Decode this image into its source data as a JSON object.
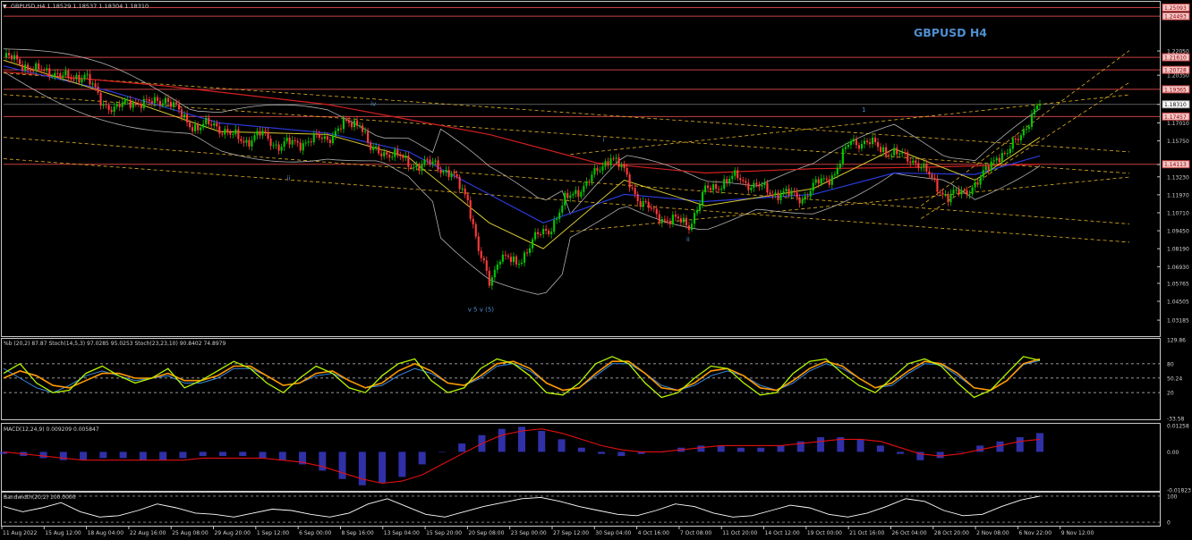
{
  "window": {
    "header": "GBPUSD,H4  1.18529 1.18537 1.18304 1.18310",
    "symbol_title": "GBPUSD H4"
  },
  "colors": {
    "background": "#000000",
    "bull": "#00c800",
    "bear": "#ff3b3b",
    "ma_slow": "#d42020",
    "ma_mid": "#2a3ad8",
    "ma_fast": "#d8c830",
    "bands": "#b0b0b0",
    "channel": "#e0b020",
    "hline": "#c84040",
    "title": "#4f8fd0",
    "stoch_main": "#b5f500",
    "stoch_fast": "#ff9a00",
    "pctb": "#3a8ae0",
    "macd_hist": "#4040e0",
    "macd_signal": "#e01010",
    "bandwidth": "#ffffff"
  },
  "chart_data": {
    "type": "candlestick",
    "ylim": [
      1.02,
      1.255
    ],
    "x_labels": [
      "11 Aug 2022",
      "15 Aug 12:00",
      "18 Aug 04:00",
      "22 Aug 16:00",
      "25 Aug 08:00",
      "29 Aug 20:00",
      "1 Sep 12:00",
      "6 Sep 00:00",
      "8 Sep 16:00",
      "13 Sep 04:00",
      "15 Sep 20:00",
      "20 Sep 08:00",
      "23 Sep 00:00",
      "27 Sep 12:00",
      "30 Sep 04:00",
      "4 Oct 16:00",
      "7 Oct 08:00",
      "11 Oct 20:00",
      "14 Oct 12:00",
      "19 Oct 00:00",
      "21 Oct 16:00",
      "26 Oct 04:00",
      "28 Oct 20:00",
      "2 Nov 08:00",
      "6 Nov 22:00",
      "9 Nov 12:00"
    ],
    "y_ticks": [
      "1.22050",
      "1.20350",
      "1.18310",
      "1.17010",
      "1.15750",
      "1.14090",
      "1.13230",
      "1.11970",
      "1.10710",
      "1.09450",
      "1.08190",
      "1.06930",
      "1.05765",
      "1.04505",
      "1.03185"
    ],
    "price_boxes": [
      {
        "label": "1.25093",
        "value": 1.25093
      },
      {
        "label": "1.24493",
        "value": 1.24493
      },
      {
        "label": "1.21610",
        "value": 1.2161
      },
      {
        "label": "1.20728",
        "value": 1.20728
      },
      {
        "label": "1.19365",
        "value": 1.19365
      },
      {
        "label": "1.17457",
        "value": 1.17457
      },
      {
        "label": "1.14113",
        "value": 1.14113
      }
    ],
    "current_price": {
      "label": "1.18310",
      "value": 1.1831
    },
    "wave_labels": [
      {
        "text": "iv",
        "value": 1.182,
        "bar": 136
      },
      {
        "text": "ii",
        "value": 1.13,
        "bar": 105
      },
      {
        "text": "i",
        "value": 1.157,
        "bar": 222
      },
      {
        "text": "ii",
        "value": 1.087,
        "bar": 253
      },
      {
        "text": "1",
        "value": 1.178,
        "bar": 318
      },
      {
        "text": "v  5  v (5)",
        "value": 1.038,
        "bar": 172
      }
    ],
    "series": [
      {
        "name": "Price",
        "points": [
          {
            "x": 0,
            "y": 1.216
          },
          {
            "x": 6,
            "y": 1.213
          },
          {
            "x": 12,
            "y": 1.206
          },
          {
            "x": 18,
            "y": 1.207
          },
          {
            "x": 24,
            "y": 1.2
          },
          {
            "x": 30,
            "y": 1.205
          },
          {
            "x": 36,
            "y": 1.185
          },
          {
            "x": 42,
            "y": 1.18
          },
          {
            "x": 48,
            "y": 1.186
          },
          {
            "x": 54,
            "y": 1.183
          },
          {
            "x": 60,
            "y": 1.188
          },
          {
            "x": 66,
            "y": 1.175
          },
          {
            "x": 72,
            "y": 1.166
          },
          {
            "x": 78,
            "y": 1.17
          },
          {
            "x": 84,
            "y": 1.161
          },
          {
            "x": 90,
            "y": 1.158
          },
          {
            "x": 96,
            "y": 1.162
          },
          {
            "x": 102,
            "y": 1.154
          },
          {
            "x": 108,
            "y": 1.156
          },
          {
            "x": 114,
            "y": 1.158
          },
          {
            "x": 120,
            "y": 1.16
          },
          {
            "x": 126,
            "y": 1.168
          },
          {
            "x": 132,
            "y": 1.172
          },
          {
            "x": 136,
            "y": 1.15
          },
          {
            "x": 142,
            "y": 1.15
          },
          {
            "x": 148,
            "y": 1.144
          },
          {
            "x": 154,
            "y": 1.14
          },
          {
            "x": 160,
            "y": 1.142
          },
          {
            "x": 166,
            "y": 1.133
          },
          {
            "x": 172,
            "y": 1.118
          },
          {
            "x": 176,
            "y": 1.08
          },
          {
            "x": 180,
            "y": 1.058
          },
          {
            "x": 184,
            "y": 1.078
          },
          {
            "x": 190,
            "y": 1.07
          },
          {
            "x": 196,
            "y": 1.088
          },
          {
            "x": 202,
            "y": 1.095
          },
          {
            "x": 208,
            "y": 1.115
          },
          {
            "x": 214,
            "y": 1.125
          },
          {
            "x": 220,
            "y": 1.135
          },
          {
            "x": 225,
            "y": 1.148
          },
          {
            "x": 230,
            "y": 1.135
          },
          {
            "x": 236,
            "y": 1.115
          },
          {
            "x": 242,
            "y": 1.105
          },
          {
            "x": 248,
            "y": 1.102
          },
          {
            "x": 254,
            "y": 1.099
          },
          {
            "x": 260,
            "y": 1.122
          },
          {
            "x": 266,
            "y": 1.128
          },
          {
            "x": 272,
            "y": 1.132
          },
          {
            "x": 278,
            "y": 1.126
          },
          {
            "x": 284,
            "y": 1.122
          },
          {
            "x": 290,
            "y": 1.12
          },
          {
            "x": 296,
            "y": 1.118
          },
          {
            "x": 302,
            "y": 1.128
          },
          {
            "x": 308,
            "y": 1.135
          },
          {
            "x": 314,
            "y": 1.158
          },
          {
            "x": 320,
            "y": 1.156
          },
          {
            "x": 326,
            "y": 1.152
          },
          {
            "x": 332,
            "y": 1.147
          },
          {
            "x": 338,
            "y": 1.144
          },
          {
            "x": 344,
            "y": 1.13
          },
          {
            "x": 350,
            "y": 1.118
          },
          {
            "x": 356,
            "y": 1.122
          },
          {
            "x": 362,
            "y": 1.13
          },
          {
            "x": 368,
            "y": 1.148
          },
          {
            "x": 372,
            "y": 1.148
          },
          {
            "x": 378,
            "y": 1.166
          },
          {
            "x": 384,
            "y": 1.1831
          }
        ]
      }
    ],
    "ma_levels": {
      "slow": [
        [
          0,
          1.206
        ],
        [
          60,
          1.196
        ],
        [
          120,
          1.183
        ],
        [
          180,
          1.162
        ],
        [
          220,
          1.142
        ],
        [
          260,
          1.135
        ],
        [
          300,
          1.138
        ],
        [
          340,
          1.139
        ],
        [
          384,
          1.141
        ]
      ],
      "mid": [
        [
          0,
          1.21
        ],
        [
          40,
          1.192
        ],
        [
          80,
          1.17
        ],
        [
          120,
          1.163
        ],
        [
          150,
          1.15
        ],
        [
          180,
          1.12
        ],
        [
          200,
          1.1
        ],
        [
          230,
          1.12
        ],
        [
          260,
          1.115
        ],
        [
          300,
          1.12
        ],
        [
          330,
          1.135
        ],
        [
          360,
          1.134
        ],
        [
          384,
          1.147
        ]
      ],
      "fast": [
        [
          0,
          1.214
        ],
        [
          40,
          1.19
        ],
        [
          80,
          1.164
        ],
        [
          120,
          1.162
        ],
        [
          150,
          1.146
        ],
        [
          180,
          1.1
        ],
        [
          200,
          1.082
        ],
        [
          230,
          1.13
        ],
        [
          260,
          1.112
        ],
        [
          300,
          1.124
        ],
        [
          330,
          1.152
        ],
        [
          360,
          1.13
        ],
        [
          384,
          1.16
        ]
      ]
    },
    "channels": [
      [
        [
          0,
          1.205
        ],
        [
          384,
          1.155
        ]
      ],
      [
        [
          0,
          1.19
        ],
        [
          384,
          1.14
        ]
      ],
      [
        [
          0,
          1.16
        ],
        [
          384,
          1.105
        ]
      ],
      [
        [
          0,
          1.145
        ],
        [
          384,
          1.092
        ]
      ],
      [
        [
          210,
          1.148
        ],
        [
          384,
          1.182
        ]
      ],
      [
        [
          210,
          1.094
        ],
        [
          384,
          1.125
        ]
      ],
      [
        [
          340,
          1.103
        ],
        [
          384,
          1.153
        ]
      ],
      [
        [
          340,
          1.112
        ],
        [
          384,
          1.169
        ]
      ]
    ],
    "indicators": {
      "stoch": {
        "label": "%b (20,2) 87.87  Stoch(14,5,3) 97.0285 95.0253  Stoch(23,23,10) 90.8402 74.8979",
        "ylim": [
          -33.58,
          129.86
        ],
        "y_ticks": [
          "129.86",
          "80",
          "50.24",
          "20",
          "-33.58"
        ],
        "main": [
          60,
          80,
          40,
          20,
          25,
          60,
          75,
          55,
          40,
          50,
          70,
          30,
          45,
          65,
          85,
          70,
          40,
          20,
          50,
          75,
          60,
          30,
          20,
          55,
          80,
          90,
          45,
          20,
          30,
          70,
          90,
          80,
          55,
          20,
          15,
          40,
          80,
          95,
          80,
          40,
          10,
          20,
          50,
          75,
          70,
          40,
          15,
          20,
          60,
          85,
          90,
          60,
          35,
          20,
          50,
          80,
          90,
          75,
          40,
          10,
          25,
          60,
          95,
          87
        ],
        "slow": [
          50,
          65,
          55,
          35,
          30,
          45,
          60,
          60,
          50,
          50,
          60,
          45,
          45,
          55,
          75,
          75,
          55,
          35,
          40,
          60,
          65,
          45,
          30,
          40,
          65,
          80,
          65,
          40,
          35,
          55,
          80,
          85,
          70,
          40,
          25,
          30,
          60,
          85,
          85,
          60,
          30,
          25,
          40,
          65,
          70,
          55,
          30,
          25,
          45,
          70,
          85,
          75,
          50,
          30,
          40,
          65,
          85,
          80,
          60,
          30,
          25,
          45,
          80,
          90
        ],
        "pctb": [
          70,
          50,
          30,
          20,
          35,
          55,
          65,
          55,
          45,
          50,
          55,
          40,
          40,
          50,
          70,
          70,
          55,
          35,
          40,
          55,
          60,
          45,
          30,
          35,
          55,
          70,
          60,
          40,
          35,
          50,
          75,
          80,
          65,
          40,
          25,
          30,
          55,
          80,
          80,
          60,
          35,
          25,
          35,
          55,
          65,
          55,
          35,
          25,
          40,
          65,
          80,
          70,
          50,
          30,
          35,
          60,
          80,
          78,
          55,
          30,
          25,
          45,
          78,
          87
        ]
      },
      "macd": {
        "label": "MACD(12,24,9) 0.009209 0.005847",
        "ylim": [
          -0.01823,
          0.01258
        ],
        "y_ticks": [
          "0.01258",
          "0.00",
          "-0.01823"
        ],
        "hist": [
          -0.001,
          -0.002,
          -0.003,
          -0.004,
          -0.004,
          -0.003,
          -0.003,
          -0.004,
          -0.004,
          -0.003,
          -0.002,
          -0.002,
          -0.002,
          -0.003,
          -0.004,
          -0.006,
          -0.009,
          -0.013,
          -0.016,
          -0.015,
          -0.012,
          -0.006,
          0.0,
          0.004,
          0.008,
          0.011,
          0.012,
          0.01,
          0.006,
          0.002,
          -0.001,
          -0.002,
          -0.001,
          0.0,
          0.002,
          0.003,
          0.003,
          0.002,
          0.002,
          0.003,
          0.005,
          0.007,
          0.007,
          0.006,
          0.003,
          -0.001,
          -0.004,
          -0.003,
          0.0,
          0.003,
          0.005,
          0.007,
          0.009
        ],
        "signal": [
          0.0,
          -0.001,
          -0.002,
          -0.003,
          -0.004,
          -0.004,
          -0.004,
          -0.004,
          -0.004,
          -0.004,
          -0.003,
          -0.003,
          -0.003,
          -0.003,
          -0.004,
          -0.005,
          -0.007,
          -0.01,
          -0.013,
          -0.015,
          -0.014,
          -0.011,
          -0.006,
          -0.001,
          0.004,
          0.008,
          0.01,
          0.011,
          0.009,
          0.006,
          0.003,
          0.001,
          0.0,
          0.0,
          0.001,
          0.002,
          0.003,
          0.003,
          0.003,
          0.003,
          0.004,
          0.005,
          0.006,
          0.006,
          0.005,
          0.002,
          -0.001,
          -0.002,
          -0.001,
          0.001,
          0.003,
          0.005,
          0.006
        ]
      },
      "bandwidth": {
        "label": "Bandwidth(20,2) 100.0000",
        "ylim": [
          -10,
          110
        ],
        "y_ticks": [
          "100",
          "0"
        ],
        "values": [
          60,
          40,
          55,
          75,
          40,
          20,
          25,
          45,
          70,
          55,
          35,
          30,
          20,
          35,
          50,
          45,
          30,
          20,
          35,
          70,
          90,
          60,
          30,
          20,
          40,
          60,
          75,
          90,
          95,
          80,
          60,
          45,
          30,
          25,
          45,
          70,
          60,
          35,
          20,
          25,
          45,
          65,
          55,
          30,
          20,
          35,
          60,
          90,
          80,
          45,
          25,
          30,
          60,
          85,
          100
        ]
      }
    }
  }
}
